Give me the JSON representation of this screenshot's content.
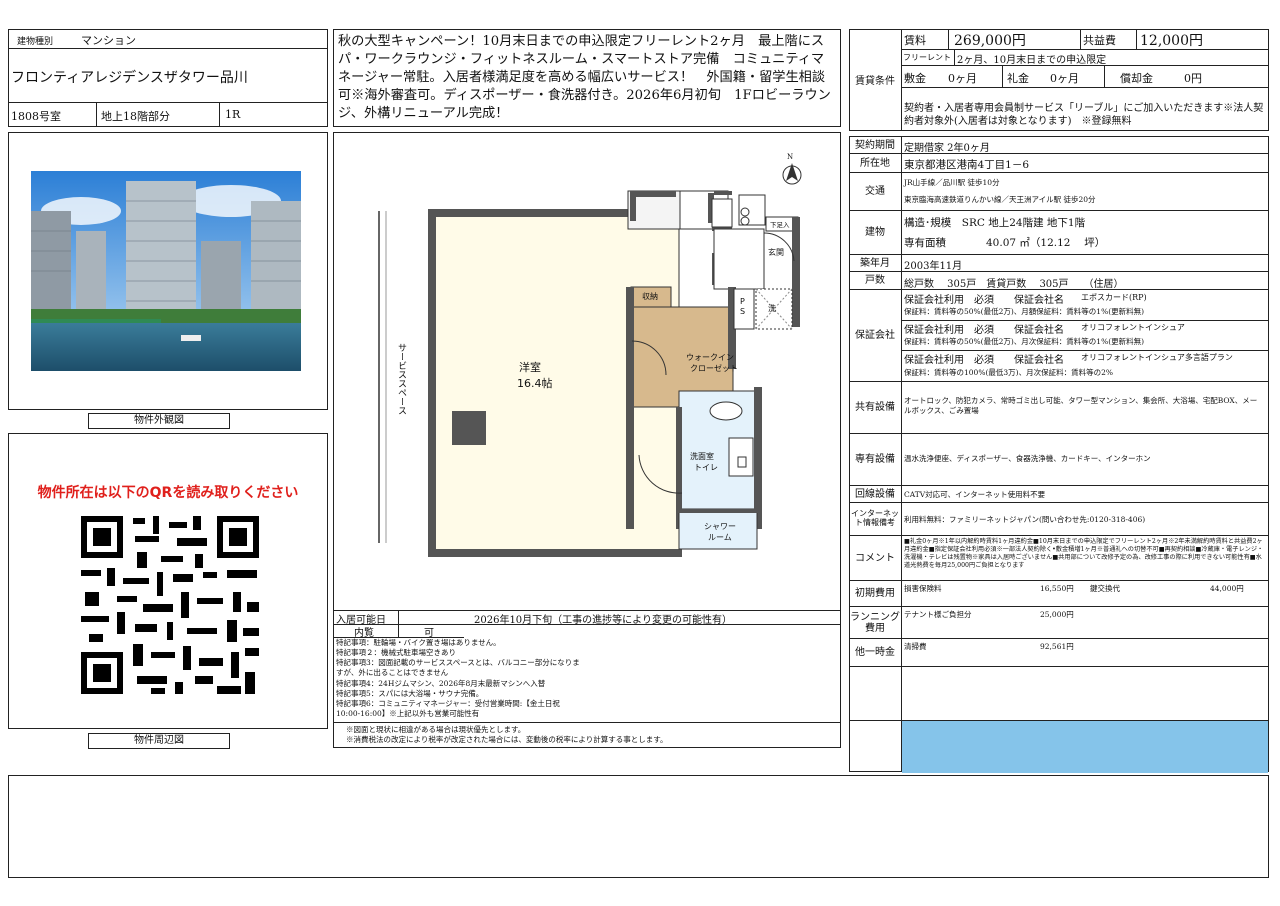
{
  "header": {
    "type_label": "建物種別",
    "type_value": "マンション",
    "name": "フロンティアレジデンスザタワー品川",
    "room": "1808号室",
    "floor": "地上18階部分",
    "layout": "1R"
  },
  "campaign": "秋の大型キャンペーン！10月末日までの申込限定フリーレント2ヶ月　最上階にスパ・ワークラウンジ・フィットネスルーム・スマートストア完備　コミュニティマネージャー常駐。入居者様満足度を高める幅広いサービス！　外国籍・留学生相談可※海外審査可。ディスポーザー・食洗器付き。2026年6月初旬　1Fロビーラウンジ、外構リニューアル完成！",
  "photo_caption": "物件外観図",
  "qr_title": "物件所在は以下のQRを読み取りください",
  "map_caption": "物件周辺図",
  "floorplan": {
    "service_space": "サービススペース",
    "western_room": "洋室",
    "western_size": "16.4帖",
    "storage": "収納",
    "walkin": "ウォークイン",
    "closet": "クローゼット",
    "ps": "P\nS",
    "washer": "洗",
    "entrance": "玄関",
    "shoe": "下足入",
    "washroom": "洗面室",
    "toilet": "トイレ",
    "shower": "シャワー",
    "shower2": "ルーム",
    "north": "N"
  },
  "movein": {
    "label": "入居可能日",
    "value": "2026年10月下旬（工事の進捗等により変更の可能性有）",
    "viewing_label": "内覧",
    "viewing_value": "可"
  },
  "notes": [
    "特記事項：駐輪場・バイク置き場はありません。",
    "特記事項２：機械式駐車場空きあり",
    "特記事項3：図面記載のサービススペースとは、バルコニー部分になりますが、外に出ることはできません",
    "特記事項4：24Hジムマシン、2026年8月末最新マシンへ入替",
    "特記事項5：スパには大浴場・サウナ完備。",
    "特記事項6：コミュニティマネージャー：受付営業時間:【金土日祝 10:00-16:00】※上記以外も営業可能性有"
  ],
  "footnotes": [
    "※図面と現状に相違がある場合は現状優先とします。",
    "※消費税法の改定により税率が改定された場合には、変動後の税率により計算する事とします。"
  ],
  "rent": {
    "section_label": "賃貸条件",
    "rent_label": "賃料",
    "rent_value": "269,000円",
    "fee_label": "共益費",
    "fee_value": "12,000円",
    "freerent_label": "フリーレント",
    "freerent_value": "2ヶ月、10月末日までの申込限定",
    "deposit_label": "敷金",
    "deposit_value": "0ヶ月",
    "key_label": "礼金",
    "key_value": "0ヶ月",
    "amort_label": "償却金",
    "amort_value": "0円",
    "member_note": "契約者・入居者専用会員制サービス「リーブル」にご加入いただきます※法人契約者対象外(入居者は対象となります)　※登録無料"
  },
  "details": {
    "contract_label": "契約期間",
    "contract_value": "定期借家 2年0ヶ月",
    "location_label": "所在地",
    "location_value": "東京都港区港南4丁目1－6",
    "transit_label": "交通",
    "transit_1": "JR山手線／品川駅 徒歩10分",
    "transit_2": "東京臨海高速鉄道りんかい線／天王洲アイル駅 徒歩20分",
    "building_label": "建物",
    "structure": "構造･規模　SRC 地上24階建 地下1階",
    "area_label": "専有面積",
    "area_value": "40.07 ㎡（12.12　 坪）",
    "built_label": "築年月",
    "built_value": "2003年11月",
    "units_label": "戸数",
    "units_value": "総戸数　 305戸　賃貸戸数　 305戸　　（住居）",
    "guarantee_label": "保証会社",
    "guarantee": [
      {
        "main": "保証会社利用　必須　　保証会社名",
        "company": "エポスカード(RP)",
        "sub": "保証料：賃料等の50%(最低2万)、月額保証料：賃料等の1%(更新料無)"
      },
      {
        "main": "保証会社利用　必須　　保証会社名",
        "company": "オリコフォレントインシュア",
        "sub": "保証料：賃料等の50%(最低2万)、月次保証料：賃料等の1%(更新料無)"
      },
      {
        "main": "保証会社利用　必須　　保証会社名",
        "company": "オリコフォレントインシュア多言語プラン",
        "sub": "保証料：賃料等の100%(最低3万)、月次保証料：賃料等の2%"
      }
    ],
    "common_label": "共有設備",
    "common_value": "オートロック、防犯カメラ、常時ゴミ出し可能、タワー型マンション、集会所、大浴場、宅配BOX、メールボックス、ごみ置場",
    "private_label": "専有設備",
    "private_value": "温水洗浄便座、ディスポーザー、食器洗浄機、カードキー、インターホン",
    "line_label": "回線設備",
    "line_value": "CATV対応可、インターネット使用料不要",
    "internet_label": "インターネット情報備考",
    "internet_value": "利用料無料：ファミリーネットジャパン(問い合わせ先:0120-318-406)",
    "comment_label": "コメント",
    "comment_value": "■礼金0ヶ月※1年以内解約時賃料1ヶ月違約金■10月末日までの申込限定でフリーレント2ヶ月※2年未満解約時賃料と共益費2ヶ月違約金■指定保証会社利用必須※一部法人契約除く•敷金積増1ヶ月※普通礼への切替不可■再契約相談■冷蔵庫・電子レンジ・洗濯機・テレビは残置物※家具は入居時ございません■共用部について改修予定の為、改修工事の際に利用できない可能性有■水道光熱費を毎月25,000円ご負担となります",
    "initial_label": "初期費用",
    "insurance_label": "損害保険料",
    "insurance_value": "16,550円",
    "keychange_label": "鍵交換代",
    "keychange_value": "44,000円",
    "running_label": "ランニング費用",
    "running_item": "テナント様ご負担分",
    "running_value": "25,000円",
    "onetime_label": "他一時金",
    "onetime_item": "清掃費",
    "onetime_value": "92,561円"
  }
}
